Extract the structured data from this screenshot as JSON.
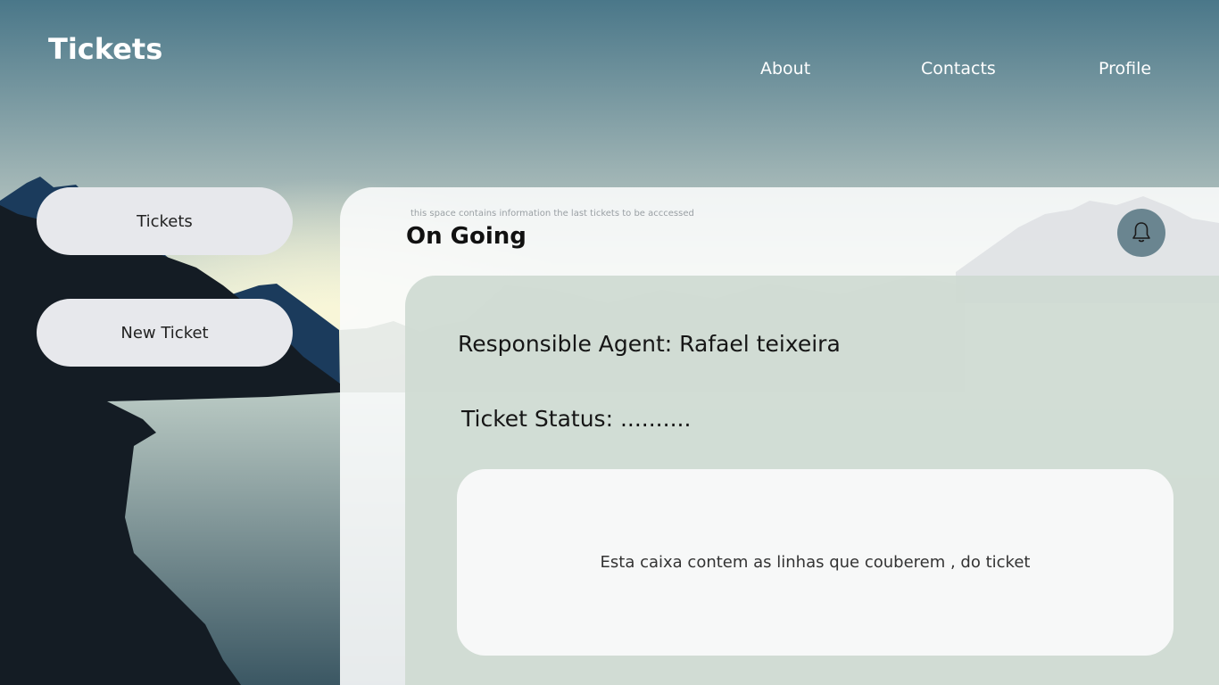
{
  "header": {
    "app_title": "Tickets",
    "nav": [
      {
        "label": "About"
      },
      {
        "label": "Contacts"
      },
      {
        "label": "Profile"
      }
    ]
  },
  "sidebar": {
    "items": [
      {
        "label": "Tickets"
      },
      {
        "label": "New Ticket"
      }
    ]
  },
  "main": {
    "hint": "this space contains information the last tickets to be acccessed",
    "section_title": "On Going",
    "notification_icon": "bell-icon",
    "ticket": {
      "agent": "Responsible Agent: Rafael teixeira",
      "status": "Ticket Status: ..........",
      "content": "Esta caixa contem as linhas que couberem , do ticket"
    }
  },
  "colors": {
    "sky_top": "#4a7789",
    "sky_bottom": "#c5d2cf",
    "mountain_dark": "#141c24",
    "mountain_blue": "#1b3b5c",
    "button_bg": "#e7e8ec",
    "bell_bg": "#6a8590",
    "card_bg": "#cfdad2"
  }
}
